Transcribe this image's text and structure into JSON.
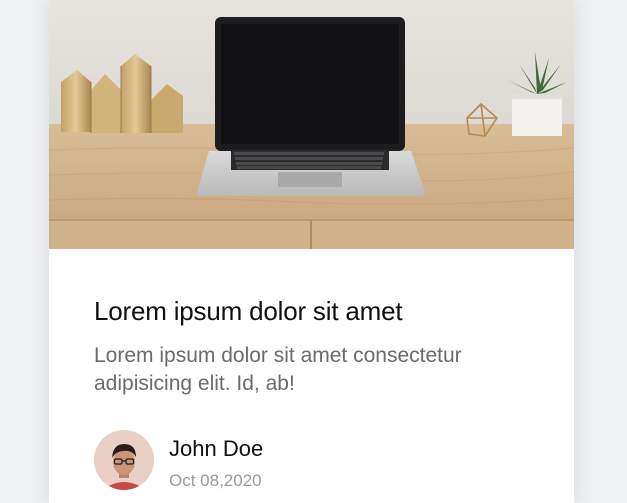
{
  "card": {
    "image_alt": "Laptop on a wooden desk",
    "title": "Lorem ipsum dolor sit amet",
    "description": "Lorem ipsum dolor sit amet consectetur adipisicing elit. Id, ab!",
    "author": {
      "name": "John Doe",
      "date": "Oct 08,2020"
    }
  },
  "colors": {
    "page_background": "#eef1f2",
    "card_background": "#ffffff",
    "title_text": "#111111",
    "description_text": "#6b6b6b",
    "date_text": "#9a9a9a"
  }
}
